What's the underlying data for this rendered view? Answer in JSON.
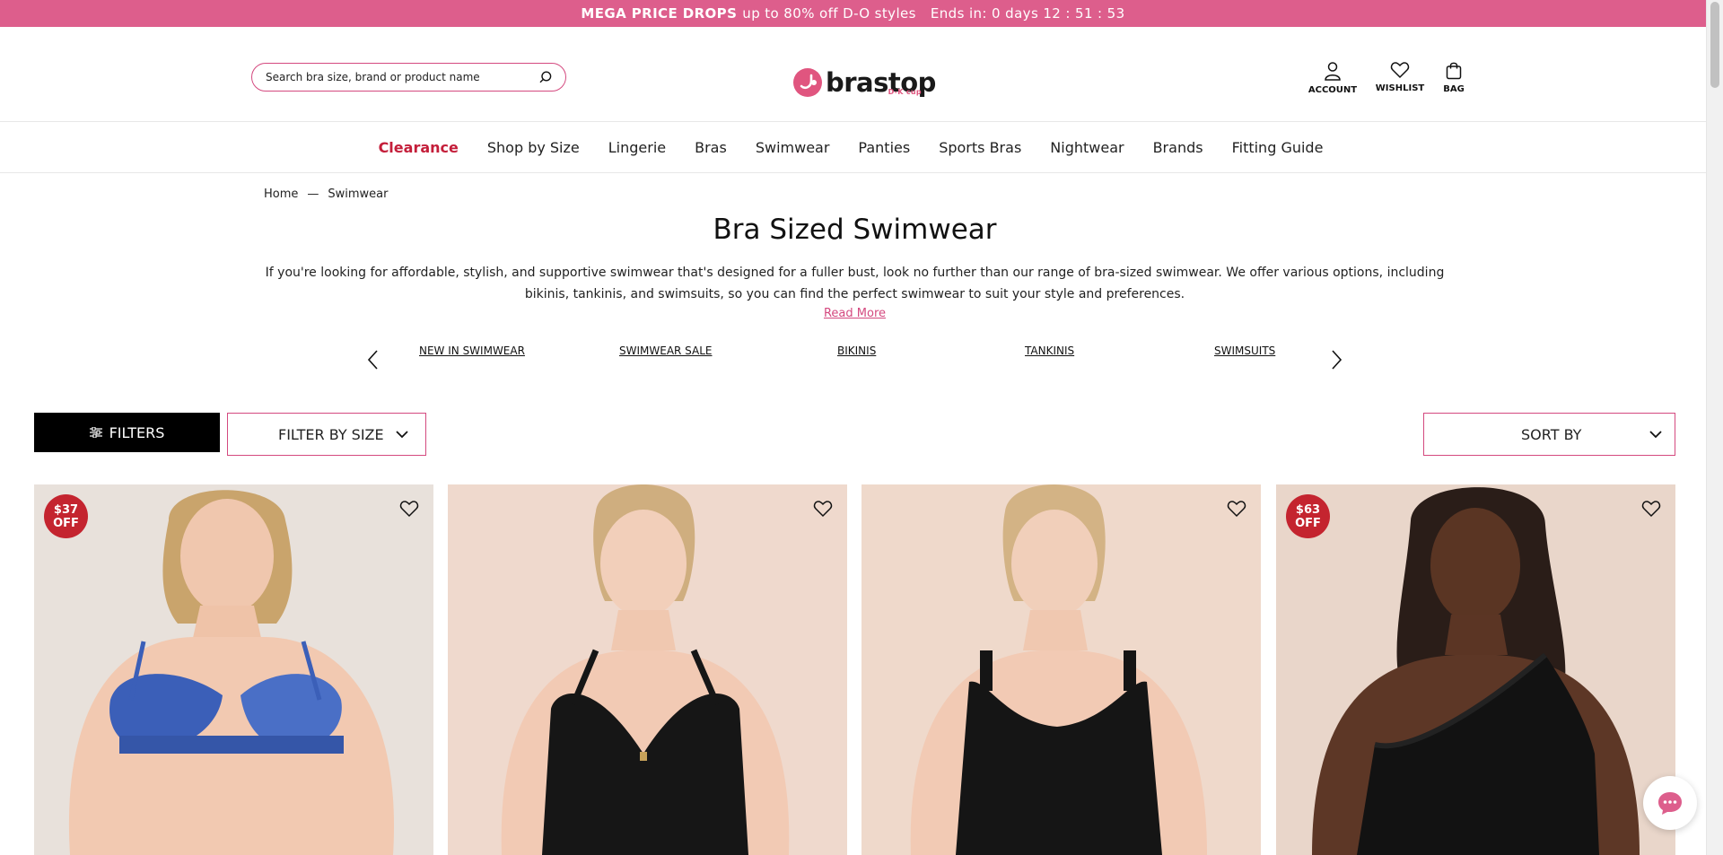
{
  "promo": {
    "headline": "MEGA PRICE DROPS",
    "text": "up to 80% off D-O styles",
    "timer": "Ends in: 0 days 12 : 51 : 53"
  },
  "header": {
    "search_placeholder": "Search bra size, brand or product name",
    "logo_word": "brastop",
    "logo_sub": "D-K cup",
    "icons": [
      {
        "label": "ACCOUNT",
        "icon": "user-icon"
      },
      {
        "label": "WISHLIST",
        "icon": "heart-icon"
      },
      {
        "label": "BAG",
        "icon": "bag-icon"
      }
    ]
  },
  "nav": {
    "items": [
      "Clearance",
      "Shop by Size",
      "Lingerie",
      "Bras",
      "Swimwear",
      "Panties",
      "Sports Bras",
      "Nightwear",
      "Brands",
      "Fitting Guide"
    ]
  },
  "breadcrumb": {
    "home": "Home",
    "separator": "—",
    "current": "Swimwear"
  },
  "page": {
    "title": "Bra Sized Swimwear",
    "description": "If you're looking for affordable, stylish, and supportive swimwear that's designed for a fuller bust, look no further than our range of bra-sized swimwear. We offer various options, including bikinis, tankinis, and swimsuits, so you can find the perfect swimwear to suit your style and preferences.",
    "read_more": "Read More"
  },
  "categories": [
    "NEW IN SWIMWEAR",
    "SWIMWEAR SALE",
    "BIKINIS",
    "TANKINIS",
    "SWIMSUITS"
  ],
  "controls": {
    "filters": "FILTERS",
    "filter_by_size": "FILTER BY SIZE",
    "sort_by": "SORT BY"
  },
  "products": [
    {
      "badge_amount": "$37",
      "badge_word": "OFF"
    },
    {
      "badge_amount": "",
      "badge_word": ""
    },
    {
      "badge_amount": "",
      "badge_word": ""
    },
    {
      "badge_amount": "$63",
      "badge_word": "OFF"
    }
  ],
  "colors": {
    "brand_pink": "#dd5e8c",
    "accent_pink": "#d4497f",
    "sale_red": "#c41e3a",
    "badge_red": "#c4242f"
  }
}
